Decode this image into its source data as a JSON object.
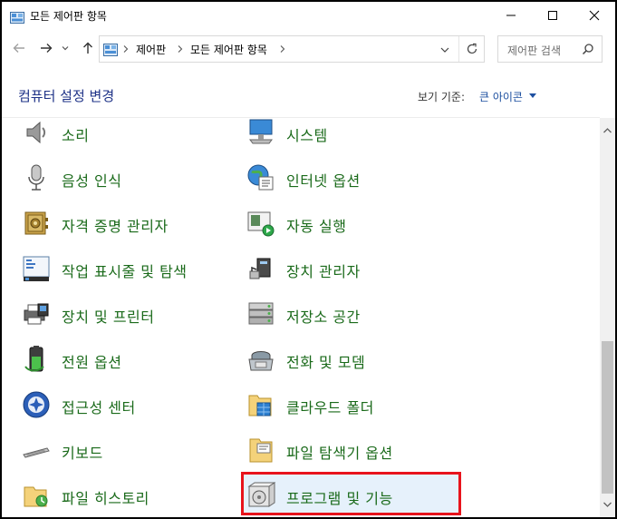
{
  "window": {
    "title": "모든 제어판 항목"
  },
  "address": {
    "crumbs": [
      "제어판",
      "모든 제어판 항목"
    ],
    "search_placeholder": "제어판 검색"
  },
  "header": {
    "title": "컴퓨터 설정 변경",
    "view_label": "보기 기준:",
    "view_value": "큰 아이콘"
  },
  "items": {
    "col1": [
      {
        "label": "소리",
        "icon": "speaker-icon"
      },
      {
        "label": "음성 인식",
        "icon": "microphone-icon"
      },
      {
        "label": "자격 증명 관리자",
        "icon": "credential-vault-icon"
      },
      {
        "label": "작업 표시줄 및 탐색",
        "icon": "taskbar-icon"
      },
      {
        "label": "장치 및 프린터",
        "icon": "printer-icon"
      },
      {
        "label": "전원 옵션",
        "icon": "battery-icon"
      },
      {
        "label": "접근성 센터",
        "icon": "accessibility-icon"
      },
      {
        "label": "키보드",
        "icon": "keyboard-icon"
      },
      {
        "label": "파일 히스토리",
        "icon": "file-history-icon"
      }
    ],
    "col2": [
      {
        "label": "시스템",
        "icon": "system-monitor-icon"
      },
      {
        "label": "인터넷 옵션",
        "icon": "globe-icon"
      },
      {
        "label": "자동 실행",
        "icon": "autoplay-icon"
      },
      {
        "label": "장치 관리자",
        "icon": "device-manager-icon"
      },
      {
        "label": "저장소 공간",
        "icon": "storage-spaces-icon"
      },
      {
        "label": "전화 및 모뎀",
        "icon": "phone-icon"
      },
      {
        "label": "클라우드 폴더",
        "icon": "cloud-folder-icon"
      },
      {
        "label": "파일 탐색기 옵션",
        "icon": "folder-options-icon"
      },
      {
        "label": "프로그램 및 기능",
        "icon": "programs-features-icon"
      }
    ]
  },
  "colors": {
    "link_green": "#1a6a1a",
    "title_blue": "#1e3287",
    "highlight_border": "#e8141c"
  }
}
